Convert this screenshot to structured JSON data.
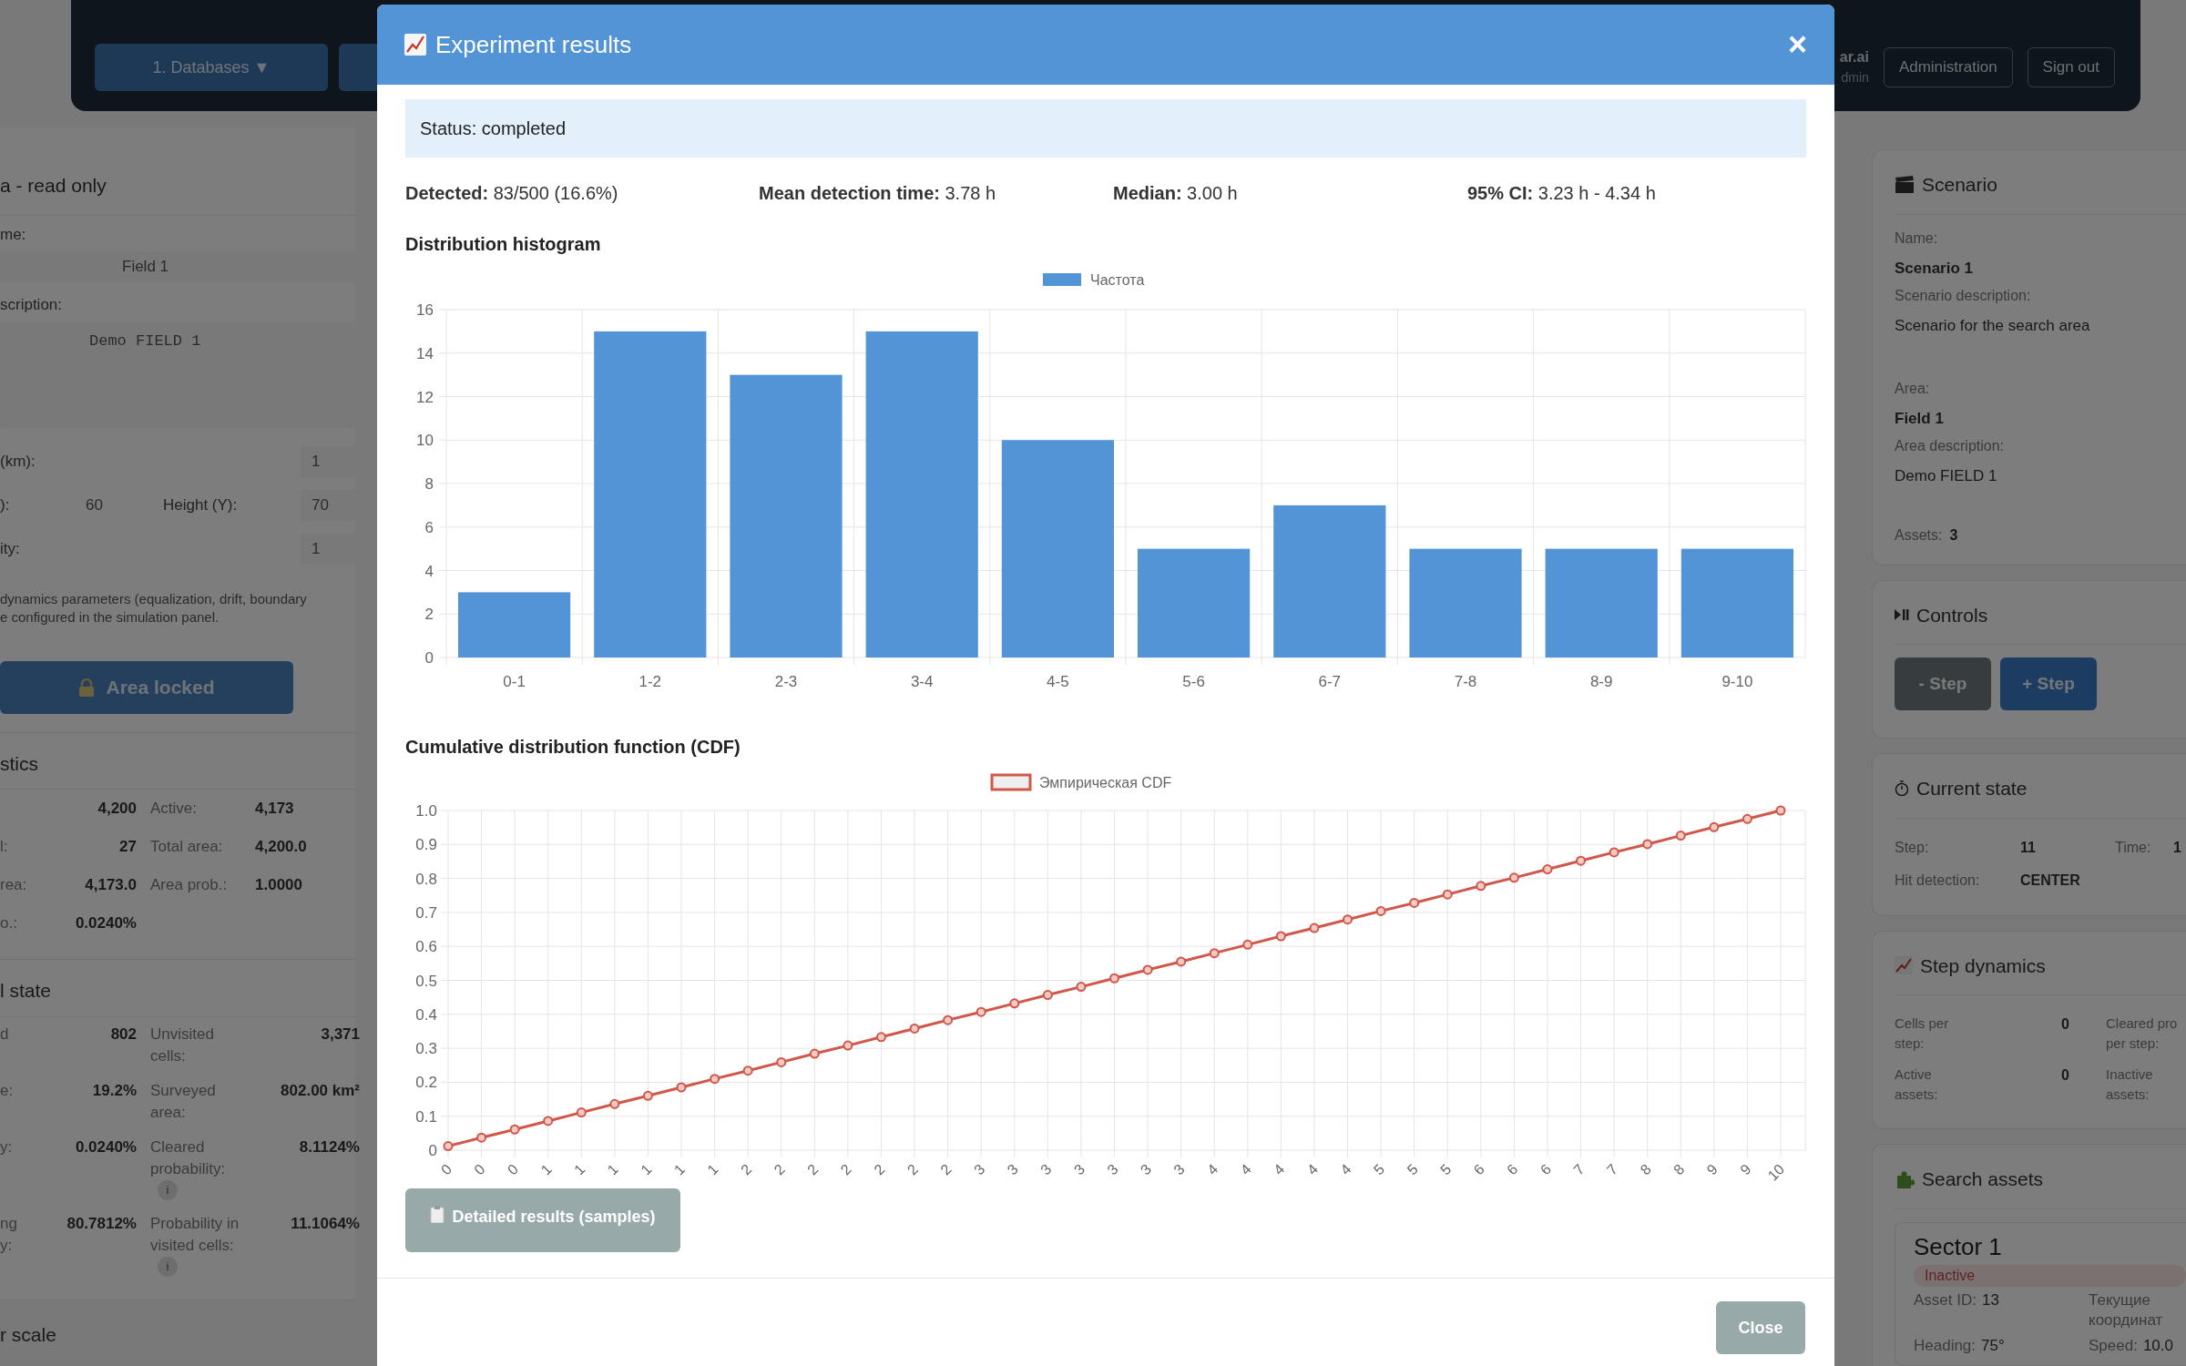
{
  "header": {
    "nav_buttons": [
      "1. Databases ▼"
    ],
    "user": {
      "name": "ar.ai",
      "role": "dmin"
    },
    "actions": [
      "Administration",
      "Sign out"
    ]
  },
  "area_panel": {
    "title": "a - read only",
    "name_label": "me:",
    "name_value": "Field 1",
    "description_label": "scription:",
    "description_value": "Demo FIELD 1",
    "cell_size": {
      "label": "(km):",
      "value": "1"
    },
    "dimensions": {
      "width_label": "):",
      "width_value": "60",
      "height_label": "Height (Y):",
      "height_value": "70"
    },
    "density": {
      "label": "ity:",
      "value": "1"
    },
    "note": [
      "dynamics parameters (equalization, drift, boundary",
      "e configured in the simulation panel."
    ],
    "lock_button": "Area locked"
  },
  "statistics": {
    "title": "stics",
    "rows": [
      [
        {
          "value": "4,200"
        },
        {
          "label": "Active:",
          "value": "4,173"
        }
      ],
      [
        {
          "label": "l:",
          "value": "27"
        },
        {
          "label": "Total area:",
          "value": "4,200.0"
        }
      ],
      [
        {
          "label": "rea:",
          "value": "4,173.0"
        },
        {
          "label": "Area prob.:",
          "value": "1.0000"
        }
      ],
      [
        {
          "label": "o.:",
          "value": "0.0240%"
        }
      ]
    ]
  },
  "field_state": {
    "title": "l state",
    "rows": [
      [
        {
          "label": "d",
          "value": "802"
        },
        {
          "label": "Unvisited\ncells:",
          "value": "3,371"
        }
      ],
      [
        {
          "label": "e:",
          "value": "19.2%"
        },
        {
          "label": "Surveyed\narea:",
          "value": "802.00 km²"
        }
      ],
      [
        {
          "label": "y:",
          "value": "0.0240%"
        },
        {
          "label": "Cleared\nprobability:",
          "value": "8.1124%",
          "info": "i"
        }
      ],
      [
        {
          "label": "ng\ny:",
          "value": "80.7812%"
        },
        {
          "label": "Probability in\nvisited cells:",
          "value": "11.1064%",
          "info": "i"
        }
      ]
    ]
  },
  "scale_title": "r scale",
  "scenario": {
    "title": "Scenario",
    "items": [
      {
        "label": "Name:",
        "value": "Scenario 1",
        "bold": true
      },
      {
        "label": "Scenario description:",
        "value": "Scenario for the search area",
        "bold": false
      },
      {
        "label": "Area:",
        "value": "Field 1",
        "bold": true
      },
      {
        "label": "Area description:",
        "value": "Demo FIELD 1",
        "bold": false
      }
    ],
    "assets_label": "Assets:",
    "assets_value": "3"
  },
  "controls": {
    "title": "Controls",
    "buttons": [
      {
        "label": "- Step",
        "kind": "secondary"
      },
      {
        "label": "+ Step",
        "kind": "primary"
      }
    ]
  },
  "current_state": {
    "title": "Current state",
    "rows": [
      [
        {
          "label": "Step:",
          "value": "11"
        },
        {
          "label": "Time:",
          "value": "1"
        }
      ],
      [
        {
          "label": "Hit detection:",
          "value": "CENTER"
        }
      ]
    ]
  },
  "step_dynamics": {
    "title": "Step dynamics",
    "rows": [
      [
        {
          "label": "Cells per\nstep:",
          "value": "0"
        },
        {
          "label": "Cleared pro\nper step:"
        }
      ],
      [
        {
          "label": "Active\nassets:",
          "value": "0"
        },
        {
          "label": "Inactive\nassets:"
        }
      ]
    ]
  },
  "search_assets": {
    "title": "Search assets",
    "asset": {
      "name": "Sector 1",
      "status": "Inactive",
      "active": false,
      "fields": [
        {
          "label": "Asset ID:",
          "value": "13"
        },
        {
          "label": "Текущие\nкоординат"
        },
        {
          "label": "Heading:",
          "value": "75°"
        },
        {
          "label": "Speed:",
          "value": "10.0"
        }
      ]
    }
  },
  "modal": {
    "title": "Experiment results",
    "status": "Status: completed",
    "stats": [
      "**Detected:** 83/500 (16.6%)",
      "**Mean detection time:** 3.78 h",
      "**Median:** 3.00 h",
      "**95% CI:** 3.23 h - 4.34 h"
    ],
    "histogram_title": "Distribution histogram",
    "histogram": {
      "chart_data": {
        "type": "bar",
        "categories": [
          "0-1",
          "1-2",
          "2-3",
          "3-4",
          "4-5",
          "5-6",
          "6-7",
          "7-8",
          "8-9",
          "9-10"
        ],
        "series": [
          {
            "name": "Частота",
            "color": "#5294d6",
            "values": [
              3,
              15,
              13,
              15,
              10,
              5,
              7,
              5,
              5,
              5
            ]
          }
        ],
        "grid": true,
        "ylim": [
          0,
          16
        ],
        "yticks": [
          0,
          2,
          4,
          6,
          8,
          10,
          12,
          14,
          16
        ]
      }
    },
    "cdf_title": "Cumulative distribution function (CDF)",
    "cdf": {
      "chart_data": {
        "type": "line",
        "categories": [
          "0",
          "0",
          "0",
          "1",
          "1",
          "1",
          "1",
          "1",
          "1",
          "2",
          "2",
          "2",
          "2",
          "2",
          "2",
          "2",
          "3",
          "3",
          "3",
          "3",
          "3",
          "3",
          "3",
          "4",
          "4",
          "4",
          "4",
          "4",
          "5",
          "5",
          "5",
          "6",
          "6",
          "6",
          "7",
          "7",
          "8",
          "8",
          "9",
          "9",
          "10"
        ],
        "grid": true,
        "series": [
          {
            "name": "Эмпирическая CDF",
            "color": "#d0574a",
            "marker": true,
            "values": [
              0.012,
              0.037,
              0.061,
              0.086,
              0.111,
              0.136,
              0.16,
              0.185,
              0.21,
              0.234,
              0.259,
              0.284,
              0.308,
              0.333,
              0.358,
              0.383,
              0.407,
              0.432,
              0.457,
              0.481,
              0.506,
              0.531,
              0.555,
              0.58,
              0.605,
              0.63,
              0.654,
              0.679,
              0.704,
              0.728,
              0.753,
              0.778,
              0.802,
              0.827,
              0.852,
              0.877,
              0.901,
              0.926,
              0.951,
              0.975,
              1.0
            ]
          }
        ],
        "ylim": [
          0,
          1
        ],
        "yticks": [
          {
            "value": 0,
            "label": "0"
          },
          {
            "value": 0.1,
            "label": "0.1"
          },
          {
            "value": 0.2,
            "label": "0.2"
          },
          {
            "value": 0.3,
            "label": "0.3"
          },
          {
            "value": 0.4,
            "label": "0.4"
          },
          {
            "value": 0.5,
            "label": "0.5"
          },
          {
            "value": 0.6,
            "label": "0.6"
          },
          {
            "value": 0.7,
            "label": "0.7"
          },
          {
            "value": 0.8,
            "label": "0.8"
          },
          {
            "value": 0.9,
            "label": "0.9"
          },
          {
            "value": 1,
            "label": "1.0"
          }
        ]
      }
    },
    "detail_button": "Detailed results (samples)",
    "close_button": "Close",
    "close_icon": "×"
  }
}
